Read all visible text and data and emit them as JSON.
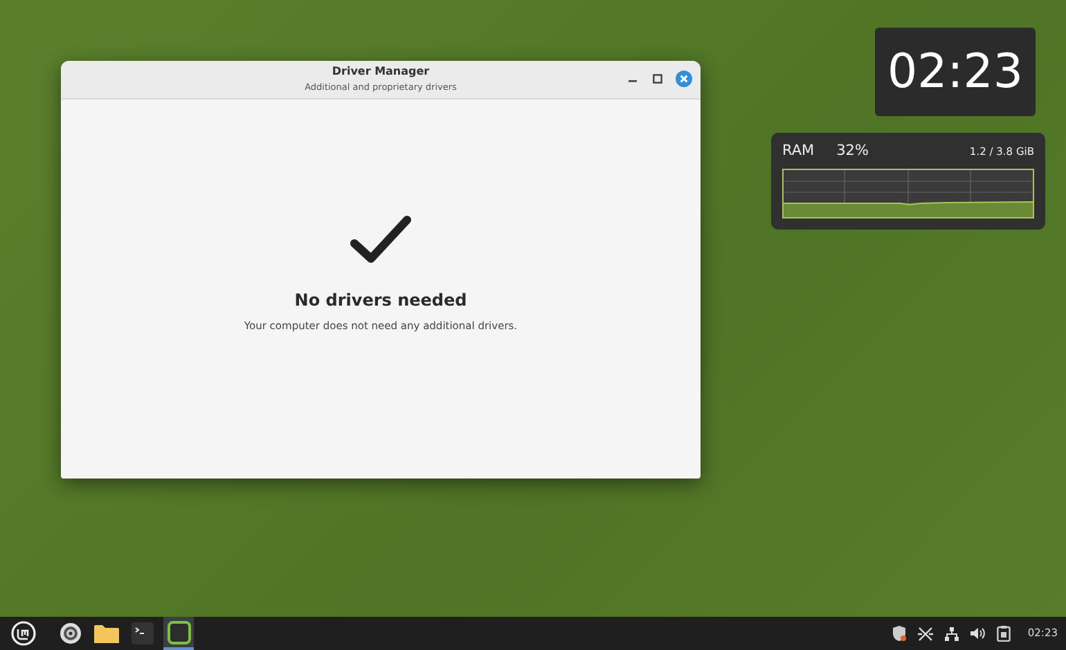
{
  "window": {
    "title": "Driver Manager",
    "subtitle": "Additional and proprietary drivers",
    "heading": "No drivers needed",
    "message": "Your computer does not need any additional drivers."
  },
  "clock_widget": {
    "time": "02:23"
  },
  "ram_widget": {
    "label": "RAM",
    "percent": "32%",
    "usage": "1.2 / 3.8 GiB"
  },
  "taskbar": {
    "launchers": [
      {
        "kind": "menu",
        "active": false
      },
      {
        "kind": "disc",
        "active": false
      },
      {
        "kind": "folder",
        "active": false
      },
      {
        "kind": "terminal",
        "active": false
      },
      {
        "kind": "window",
        "active": true
      }
    ],
    "tray": [
      {
        "kind": "shield"
      },
      {
        "kind": "cross"
      },
      {
        "kind": "network"
      },
      {
        "kind": "volume"
      },
      {
        "kind": "clipboard"
      }
    ],
    "time": "02:23"
  }
}
